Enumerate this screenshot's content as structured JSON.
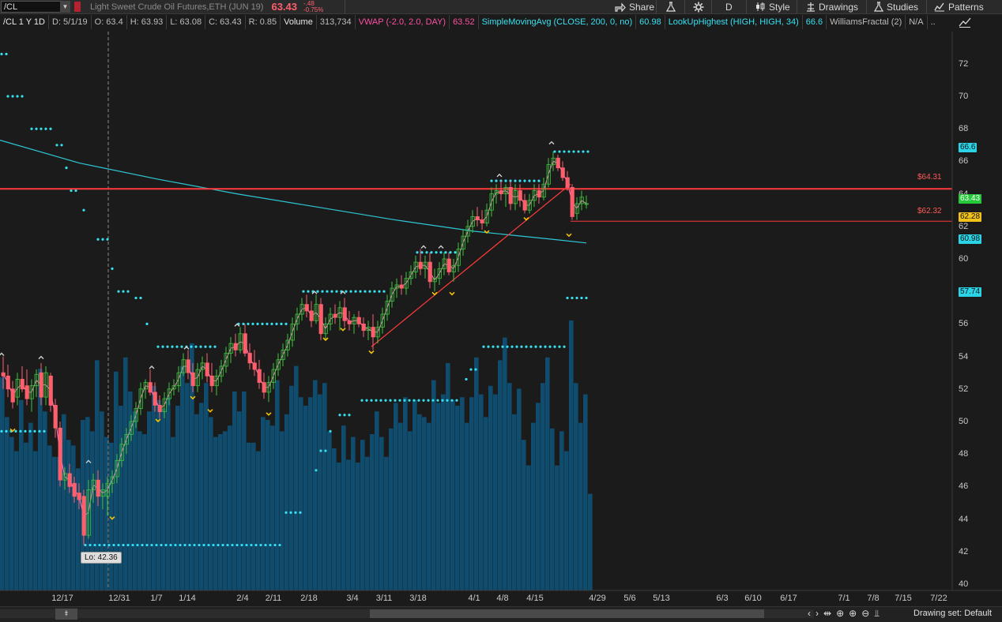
{
  "toolbar": {
    "symbol": "/CL",
    "description": "Light Sweet Crude Oil Futures,ETH (JUN 19)",
    "last_price": "63.43",
    "change_abs": "-.48",
    "change_pct": "-0.75%",
    "share_label": "Share",
    "aggregation": "D",
    "style_label": "Style",
    "drawings_label": "Drawings",
    "studies_label": "Studies",
    "patterns_label": "Patterns"
  },
  "infobar": {
    "chart_label": "/CL 1 Y 1D",
    "date": "D: 5/1/19",
    "open": "O: 63.4",
    "high": "H: 63.93",
    "low": "L: 63.08",
    "close": "C: 63.43",
    "range": "R: 0.85",
    "volume_label": "Volume",
    "volume_value": "313,734",
    "vwap_label": "VWAP (-2.0, 2.0, DAY)",
    "vwap_value": "63.52",
    "sma_label": "SimpleMovingAvg (CLOSE, 200, 0, no)",
    "sma_value": "60.98",
    "lookup_label": "LookUpHighest (HIGH, HIGH, 34)",
    "lookup_value": "66.6",
    "fractal_label": "WilliamsFractal (2)",
    "fractal_value": "N/A",
    "more": ".."
  },
  "price_tags": {
    "lookup": "66.6",
    "last": "63.43",
    "support": "62.28",
    "sma": "60.98",
    "lower": "57.74"
  },
  "line_labels": {
    "resistance": "$64.31",
    "support": "$62.32"
  },
  "lo_label": "Lo: 42.36",
  "bottom": {
    "drawing_set": "Drawing set: Default"
  },
  "colors": {
    "up_candle": "#3cc43c",
    "down_candle": "#ff5f6d",
    "sma": "#2ec8d6",
    "volume": "#0f4c6e",
    "resistance": "#ff3b3b",
    "dots": "#36e0f0",
    "fractal_up": "#d0d0d0",
    "fractal_down": "#f2c200"
  },
  "chart_data": {
    "type": "candlestick",
    "y_axis": {
      "min": 40,
      "max": 74,
      "ticks": [
        40,
        42,
        44,
        46,
        48,
        50,
        52,
        54,
        56,
        58,
        60,
        62,
        64,
        66,
        68,
        70,
        72
      ]
    },
    "x_ticks": [
      "12/17",
      "12/31",
      "1/7",
      "1/14",
      "2/4",
      "2/11",
      "2/18",
      "3/4",
      "3/11",
      "3/18",
      "4/1",
      "4/8",
      "4/15",
      "4/29",
      "5/6",
      "5/13",
      "6/3",
      "6/10",
      "6/17",
      "7/1",
      "7/8",
      "7/15",
      "7/22"
    ],
    "candles": [
      {
        "x": 2,
        "o": 53.0,
        "h": 54.0,
        "l": 52.0,
        "c": 52.8
      },
      {
        "x": 8,
        "o": 52.8,
        "h": 53.5,
        "l": 51.5,
        "c": 52.0
      },
      {
        "x": 14,
        "o": 52.0,
        "h": 52.5,
        "l": 50.8,
        "c": 51.2
      },
      {
        "x": 20,
        "o": 51.5,
        "h": 53.0,
        "l": 51.0,
        "c": 52.6
      },
      {
        "x": 26,
        "o": 52.6,
        "h": 53.4,
        "l": 51.8,
        "c": 52.0
      },
      {
        "x": 32,
        "o": 52.2,
        "h": 53.2,
        "l": 51.0,
        "c": 51.4
      },
      {
        "x": 38,
        "o": 51.4,
        "h": 52.6,
        "l": 50.6,
        "c": 52.2
      },
      {
        "x": 44,
        "o": 52.2,
        "h": 53.2,
        "l": 51.5,
        "c": 52.9
      },
      {
        "x": 50,
        "o": 53.0,
        "h": 53.6,
        "l": 51.0,
        "c": 51.5
      },
      {
        "x": 56,
        "o": 51.5,
        "h": 53.4,
        "l": 51.0,
        "c": 53.0
      },
      {
        "x": 62,
        "o": 52.8,
        "h": 53.0,
        "l": 50.6,
        "c": 51.0
      },
      {
        "x": 68,
        "o": 51.0,
        "h": 51.4,
        "l": 49.0,
        "c": 49.6
      },
      {
        "x": 74,
        "o": 49.6,
        "h": 50.0,
        "l": 46.0,
        "c": 46.4
      },
      {
        "x": 80,
        "o": 46.4,
        "h": 47.2,
        "l": 45.8,
        "c": 46.8
      },
      {
        "x": 86,
        "o": 46.8,
        "h": 47.4,
        "l": 45.6,
        "c": 46.0
      },
      {
        "x": 92,
        "o": 46.2,
        "h": 46.6,
        "l": 45.0,
        "c": 45.4
      },
      {
        "x": 98,
        "o": 45.6,
        "h": 46.2,
        "l": 44.6,
        "c": 45.2
      },
      {
        "x": 104,
        "o": 45.4,
        "h": 45.8,
        "l": 42.4,
        "c": 43.0
      },
      {
        "x": 110,
        "o": 43.0,
        "h": 46.4,
        "l": 42.8,
        "c": 45.8
      },
      {
        "x": 116,
        "o": 45.8,
        "h": 46.8,
        "l": 45.0,
        "c": 46.4
      },
      {
        "x": 122,
        "o": 46.4,
        "h": 47.0,
        "l": 44.8,
        "c": 45.4
      },
      {
        "x": 128,
        "o": 45.4,
        "h": 46.2,
        "l": 44.6,
        "c": 45.8
      },
      {
        "x": 134,
        "o": 45.4,
        "h": 46.6,
        "l": 44.2,
        "c": 46.2
      },
      {
        "x": 140,
        "o": 46.2,
        "h": 47.0,
        "l": 45.6,
        "c": 46.6
      },
      {
        "x": 146,
        "o": 46.6,
        "h": 48.0,
        "l": 46.2,
        "c": 47.6
      },
      {
        "x": 152,
        "o": 47.6,
        "h": 49.0,
        "l": 47.2,
        "c": 48.6
      },
      {
        "x": 158,
        "o": 48.6,
        "h": 49.6,
        "l": 48.0,
        "c": 49.2
      },
      {
        "x": 164,
        "o": 49.2,
        "h": 50.4,
        "l": 48.8,
        "c": 50.0
      },
      {
        "x": 170,
        "o": 50.0,
        "h": 51.2,
        "l": 49.6,
        "c": 50.8
      },
      {
        "x": 176,
        "o": 50.8,
        "h": 52.4,
        "l": 50.4,
        "c": 52.0
      },
      {
        "x": 182,
        "o": 52.0,
        "h": 52.6,
        "l": 51.4,
        "c": 52.4
      },
      {
        "x": 188,
        "o": 52.4,
        "h": 53.2,
        "l": 51.6,
        "c": 51.8
      },
      {
        "x": 194,
        "o": 51.8,
        "h": 52.4,
        "l": 50.6,
        "c": 51.0
      },
      {
        "x": 200,
        "o": 51.0,
        "h": 51.6,
        "l": 50.2,
        "c": 50.6
      },
      {
        "x": 206,
        "o": 50.6,
        "h": 51.8,
        "l": 50.2,
        "c": 51.4
      },
      {
        "x": 212,
        "o": 51.4,
        "h": 52.4,
        "l": 51.0,
        "c": 52.0
      },
      {
        "x": 218,
        "o": 52.0,
        "h": 52.6,
        "l": 51.6,
        "c": 52.2
      },
      {
        "x": 224,
        "o": 52.2,
        "h": 53.4,
        "l": 51.8,
        "c": 53.0
      },
      {
        "x": 230,
        "o": 53.0,
        "h": 54.2,
        "l": 52.8,
        "c": 53.8
      },
      {
        "x": 236,
        "o": 53.8,
        "h": 54.4,
        "l": 52.6,
        "c": 53.0
      },
      {
        "x": 242,
        "o": 53.0,
        "h": 53.6,
        "l": 51.8,
        "c": 52.2
      },
      {
        "x": 248,
        "o": 52.2,
        "h": 53.6,
        "l": 51.8,
        "c": 53.2
      },
      {
        "x": 254,
        "o": 53.2,
        "h": 54.0,
        "l": 52.6,
        "c": 53.6
      },
      {
        "x": 260,
        "o": 53.6,
        "h": 54.2,
        "l": 52.4,
        "c": 52.8
      },
      {
        "x": 266,
        "o": 52.8,
        "h": 53.6,
        "l": 51.8,
        "c": 52.2
      },
      {
        "x": 272,
        "o": 52.2,
        "h": 53.2,
        "l": 51.6,
        "c": 52.8
      },
      {
        "x": 278,
        "o": 52.8,
        "h": 53.8,
        "l": 52.4,
        "c": 53.4
      },
      {
        "x": 284,
        "o": 53.4,
        "h": 54.6,
        "l": 53.0,
        "c": 54.2
      },
      {
        "x": 290,
        "o": 54.2,
        "h": 55.2,
        "l": 53.6,
        "c": 54.8
      },
      {
        "x": 296,
        "o": 54.8,
        "h": 55.4,
        "l": 54.0,
        "c": 54.4
      },
      {
        "x": 302,
        "o": 54.4,
        "h": 55.8,
        "l": 54.2,
        "c": 55.4
      },
      {
        "x": 308,
        "o": 55.4,
        "h": 56.0,
        "l": 54.0,
        "c": 54.2
      },
      {
        "x": 314,
        "o": 54.2,
        "h": 54.8,
        "l": 53.2,
        "c": 53.6
      },
      {
        "x": 320,
        "o": 53.6,
        "h": 54.4,
        "l": 52.8,
        "c": 53.2
      },
      {
        "x": 326,
        "o": 53.2,
        "h": 53.8,
        "l": 52.0,
        "c": 52.4
      },
      {
        "x": 332,
        "o": 52.4,
        "h": 53.0,
        "l": 51.4,
        "c": 51.8
      },
      {
        "x": 338,
        "o": 51.8,
        "h": 52.8,
        "l": 51.2,
        "c": 52.4
      },
      {
        "x": 344,
        "o": 52.4,
        "h": 53.6,
        "l": 52.0,
        "c": 53.2
      },
      {
        "x": 350,
        "o": 53.2,
        "h": 54.2,
        "l": 52.8,
        "c": 53.8
      },
      {
        "x": 356,
        "o": 53.8,
        "h": 54.8,
        "l": 53.4,
        "c": 54.4
      },
      {
        "x": 362,
        "o": 54.4,
        "h": 55.4,
        "l": 54.0,
        "c": 55.0
      },
      {
        "x": 368,
        "o": 55.0,
        "h": 56.4,
        "l": 54.6,
        "c": 56.0
      },
      {
        "x": 374,
        "o": 56.0,
        "h": 57.0,
        "l": 55.6,
        "c": 56.6
      },
      {
        "x": 380,
        "o": 56.6,
        "h": 57.6,
        "l": 56.2,
        "c": 57.2
      },
      {
        "x": 386,
        "o": 57.2,
        "h": 57.8,
        "l": 56.4,
        "c": 56.8
      },
      {
        "x": 392,
        "o": 56.8,
        "h": 57.4,
        "l": 55.8,
        "c": 56.2
      },
      {
        "x": 398,
        "o": 56.2,
        "h": 57.8,
        "l": 56.0,
        "c": 57.2
      },
      {
        "x": 404,
        "o": 57.2,
        "h": 57.6,
        "l": 55.0,
        "c": 55.4
      },
      {
        "x": 410,
        "o": 55.4,
        "h": 56.4,
        "l": 55.0,
        "c": 56.0
      },
      {
        "x": 416,
        "o": 56.0,
        "h": 57.0,
        "l": 55.6,
        "c": 56.6
      },
      {
        "x": 422,
        "o": 56.6,
        "h": 57.2,
        "l": 56.0,
        "c": 56.4
      },
      {
        "x": 428,
        "o": 56.4,
        "h": 57.4,
        "l": 55.6,
        "c": 57.0
      },
      {
        "x": 434,
        "o": 57.0,
        "h": 57.6,
        "l": 55.8,
        "c": 56.2
      },
      {
        "x": 440,
        "o": 56.2,
        "h": 56.8,
        "l": 55.6,
        "c": 56.0
      },
      {
        "x": 446,
        "o": 56.0,
        "h": 56.6,
        "l": 55.4,
        "c": 56.4
      },
      {
        "x": 452,
        "o": 56.4,
        "h": 56.8,
        "l": 55.8,
        "c": 56.0
      },
      {
        "x": 458,
        "o": 56.0,
        "h": 56.4,
        "l": 55.2,
        "c": 55.6
      },
      {
        "x": 464,
        "o": 55.6,
        "h": 56.2,
        "l": 55.0,
        "c": 55.8
      },
      {
        "x": 470,
        "o": 55.8,
        "h": 56.6,
        "l": 54.4,
        "c": 55.2
      },
      {
        "x": 476,
        "o": 55.2,
        "h": 56.2,
        "l": 54.8,
        "c": 55.8
      },
      {
        "x": 482,
        "o": 55.8,
        "h": 57.0,
        "l": 55.4,
        "c": 56.6
      },
      {
        "x": 488,
        "o": 56.6,
        "h": 57.8,
        "l": 56.2,
        "c": 57.4
      },
      {
        "x": 494,
        "o": 57.4,
        "h": 58.6,
        "l": 57.0,
        "c": 58.2
      },
      {
        "x": 500,
        "o": 58.2,
        "h": 58.8,
        "l": 57.6,
        "c": 58.4
      },
      {
        "x": 506,
        "o": 58.4,
        "h": 59.0,
        "l": 57.8,
        "c": 58.2
      },
      {
        "x": 512,
        "o": 58.2,
        "h": 59.2,
        "l": 57.8,
        "c": 58.8
      },
      {
        "x": 518,
        "o": 58.8,
        "h": 59.6,
        "l": 58.4,
        "c": 59.2
      },
      {
        "x": 524,
        "o": 59.2,
        "h": 60.2,
        "l": 58.8,
        "c": 59.8
      },
      {
        "x": 530,
        "o": 59.8,
        "h": 60.6,
        "l": 59.0,
        "c": 59.4
      },
      {
        "x": 536,
        "o": 59.4,
        "h": 60.2,
        "l": 58.8,
        "c": 59.8
      },
      {
        "x": 542,
        "o": 59.8,
        "h": 60.4,
        "l": 58.2,
        "c": 58.6
      },
      {
        "x": 548,
        "o": 58.6,
        "h": 59.4,
        "l": 58.0,
        "c": 58.8
      },
      {
        "x": 554,
        "o": 58.8,
        "h": 59.8,
        "l": 58.4,
        "c": 59.4
      },
      {
        "x": 560,
        "o": 59.4,
        "h": 60.4,
        "l": 59.0,
        "c": 60.0
      },
      {
        "x": 566,
        "o": 60.0,
        "h": 60.4,
        "l": 59.0,
        "c": 59.2
      },
      {
        "x": 572,
        "o": 59.2,
        "h": 60.0,
        "l": 58.6,
        "c": 59.6
      },
      {
        "x": 578,
        "o": 59.6,
        "h": 61.0,
        "l": 59.2,
        "c": 60.6
      },
      {
        "x": 584,
        "o": 60.6,
        "h": 61.8,
        "l": 60.2,
        "c": 61.4
      },
      {
        "x": 590,
        "o": 61.4,
        "h": 62.4,
        "l": 61.0,
        "c": 62.0
      },
      {
        "x": 596,
        "o": 62.0,
        "h": 63.0,
        "l": 61.6,
        "c": 62.6
      },
      {
        "x": 602,
        "o": 62.6,
        "h": 63.2,
        "l": 62.0,
        "c": 62.4
      },
      {
        "x": 608,
        "o": 62.4,
        "h": 63.0,
        "l": 61.8,
        "c": 62.2
      },
      {
        "x": 614,
        "o": 62.2,
        "h": 63.4,
        "l": 62.0,
        "c": 63.0
      },
      {
        "x": 620,
        "o": 63.0,
        "h": 64.4,
        "l": 62.6,
        "c": 64.0
      },
      {
        "x": 626,
        "o": 64.0,
        "h": 64.6,
        "l": 63.4,
        "c": 64.2
      },
      {
        "x": 632,
        "o": 64.2,
        "h": 64.8,
        "l": 63.6,
        "c": 64.0
      },
      {
        "x": 638,
        "o": 64.0,
        "h": 64.6,
        "l": 63.2,
        "c": 64.4
      },
      {
        "x": 644,
        "o": 64.4,
        "h": 64.8,
        "l": 63.0,
        "c": 63.4
      },
      {
        "x": 650,
        "o": 63.4,
        "h": 64.6,
        "l": 63.0,
        "c": 64.2
      },
      {
        "x": 656,
        "o": 64.2,
        "h": 64.6,
        "l": 63.2,
        "c": 63.6
      },
      {
        "x": 662,
        "o": 63.6,
        "h": 64.0,
        "l": 62.8,
        "c": 63.0
      },
      {
        "x": 668,
        "o": 63.0,
        "h": 64.0,
        "l": 62.8,
        "c": 63.6
      },
      {
        "x": 674,
        "o": 63.6,
        "h": 64.6,
        "l": 63.2,
        "c": 64.2
      },
      {
        "x": 680,
        "o": 64.2,
        "h": 64.6,
        "l": 63.4,
        "c": 63.8
      },
      {
        "x": 686,
        "o": 63.8,
        "h": 65.0,
        "l": 63.6,
        "c": 64.6
      },
      {
        "x": 692,
        "o": 64.6,
        "h": 66.2,
        "l": 64.4,
        "c": 65.8
      },
      {
        "x": 698,
        "o": 65.8,
        "h": 66.6,
        "l": 65.4,
        "c": 66.2
      },
      {
        "x": 704,
        "o": 66.2,
        "h": 66.4,
        "l": 65.4,
        "c": 65.6
      },
      {
        "x": 710,
        "o": 65.6,
        "h": 66.0,
        "l": 64.8,
        "c": 65.0
      },
      {
        "x": 716,
        "o": 65.0,
        "h": 65.4,
        "l": 64.2,
        "c": 64.4
      },
      {
        "x": 722,
        "o": 64.4,
        "h": 64.6,
        "l": 62.4,
        "c": 62.6
      },
      {
        "x": 728,
        "o": 62.8,
        "h": 63.8,
        "l": 62.4,
        "c": 63.4
      },
      {
        "x": 734,
        "o": 63.4,
        "h": 64.2,
        "l": 63.0,
        "c": 63.8
      },
      {
        "x": 740,
        "o": 63.4,
        "h": 63.9,
        "l": 63.1,
        "c": 63.4
      }
    ],
    "volume_relative": [
      0.75,
      0.61,
      0.54,
      0.49,
      0.67,
      0.52,
      0.59,
      0.49,
      0.78,
      0.63,
      0.51,
      0.47,
      0.47,
      0.62,
      0.53,
      0.51,
      0.43,
      0.6,
      0.61,
      0.56,
      0.81,
      0.63,
      0.54,
      0.52,
      0.77,
      0.65,
      0.82,
      0.7,
      0.63,
      0.56,
      0.55,
      0.63,
      0.72,
      0.67,
      0.64,
      0.68,
      0.54,
      0.65,
      0.79,
      0.73,
      0.87,
      0.62,
      0.66,
      0.73,
      0.61,
      0.54,
      0.55,
      0.56,
      0.58,
      0.7,
      0.63,
      0.7,
      0.52,
      0.52,
      0.49,
      0.61,
      0.6,
      0.58,
      0.74,
      0.56,
      0.62,
      0.72,
      0.79,
      0.68,
      0.65,
      0.68,
      0.74,
      0.69,
      0.73,
      0.56,
      0.5,
      0.45,
      0.58,
      0.46,
      0.54,
      0.45,
      0.53,
      0.47,
      0.55,
      0.63,
      0.54,
      0.47,
      0.57,
      0.66,
      0.59,
      0.68,
      0.56,
      0.67,
      0.62,
      0.61,
      0.59,
      0.74,
      0.66,
      0.69,
      0.8,
      0.67,
      0.65,
      0.68,
      0.59,
      0.68,
      0.82,
      0.69,
      0.61,
      0.72,
      0.69,
      0.81,
      0.89,
      0.73,
      0.62,
      0.71,
      0.53,
      0.44,
      0.59,
      0.66,
      0.73,
      0.82,
      0.57,
      0.44,
      0.56,
      0.49,
      0.95,
      0.73,
      0.59,
      0.69,
      0.34
    ],
    "sma200": [
      [
        0,
        67.3
      ],
      [
        100,
        65.9
      ],
      [
        200,
        64.9
      ],
      [
        300,
        64.0
      ],
      [
        400,
        63.2
      ],
      [
        500,
        62.4
      ],
      [
        600,
        61.7
      ],
      [
        700,
        61.2
      ],
      [
        742,
        60.98
      ]
    ],
    "resistance_level": 64.31,
    "support_level": 62.32,
    "trendline": [
      [
        470,
        54.6
      ],
      [
        722,
        64.6
      ]
    ]
  }
}
